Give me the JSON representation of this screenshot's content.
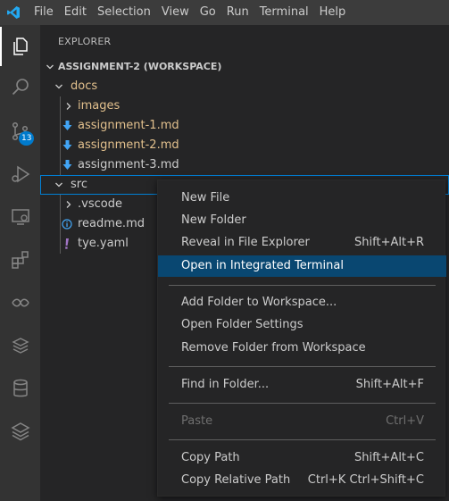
{
  "menubar": {
    "logo_icon": "vscode-logo-icon",
    "items": [
      "File",
      "Edit",
      "Selection",
      "View",
      "Go",
      "Run",
      "Terminal",
      "Help"
    ]
  },
  "activitybar": {
    "items": [
      "explorer-icon",
      "search-icon",
      "source-control-icon",
      "run-debug-icon",
      "remote-explorer-icon",
      "extensions-icon",
      "live-share-icon",
      "docker-icon",
      "database-icon",
      "stack-icon"
    ],
    "source_control_badge": "13"
  },
  "sidebar": {
    "title": "EXPLORER",
    "workspace": "ASSIGNMENT-2 (WORKSPACE)",
    "tree": [
      {
        "label": "docs",
        "icon": "chevron-down-icon"
      },
      {
        "label": "images",
        "icon": "chevron-right-icon"
      },
      {
        "label": "assignment-1.md",
        "icon": "markdown-download-icon"
      },
      {
        "label": "assignment-2.md",
        "icon": "markdown-download-icon"
      },
      {
        "label": "assignment-3.md",
        "icon": "markdown-download-icon"
      },
      {
        "label": "src",
        "icon": "chevron-down-icon"
      },
      {
        "label": ".vscode",
        "icon": "chevron-right-icon"
      },
      {
        "label": "readme.md",
        "icon": "info-icon"
      },
      {
        "label": "tye.yaml",
        "icon": "exclamation-icon"
      }
    ]
  },
  "context_menu": {
    "items": [
      {
        "label": "New File",
        "shortcut": ""
      },
      {
        "label": "New Folder",
        "shortcut": ""
      },
      {
        "label": "Reveal in File Explorer",
        "shortcut": "Shift+Alt+R"
      },
      {
        "label": "Open in Integrated Terminal",
        "shortcut": ""
      },
      {
        "label": "Add Folder to Workspace...",
        "shortcut": ""
      },
      {
        "label": "Open Folder Settings",
        "shortcut": ""
      },
      {
        "label": "Remove Folder from Workspace",
        "shortcut": ""
      },
      {
        "label": "Find in Folder...",
        "shortcut": "Shift+Alt+F"
      },
      {
        "label": "Paste",
        "shortcut": "Ctrl+V"
      },
      {
        "label": "Copy Path",
        "shortcut": "Shift+Alt+C"
      },
      {
        "label": "Copy Relative Path",
        "shortcut": "Ctrl+K Ctrl+Shift+C"
      }
    ],
    "highlighted": "Open in Integrated Terminal",
    "disabled": "Paste"
  },
  "colors": {
    "accent": "#007acc",
    "highlight": "#094771",
    "folder": "#e2c08d",
    "markdown_icon": "#42a5f5",
    "yaml_icon": "#a074c4"
  }
}
